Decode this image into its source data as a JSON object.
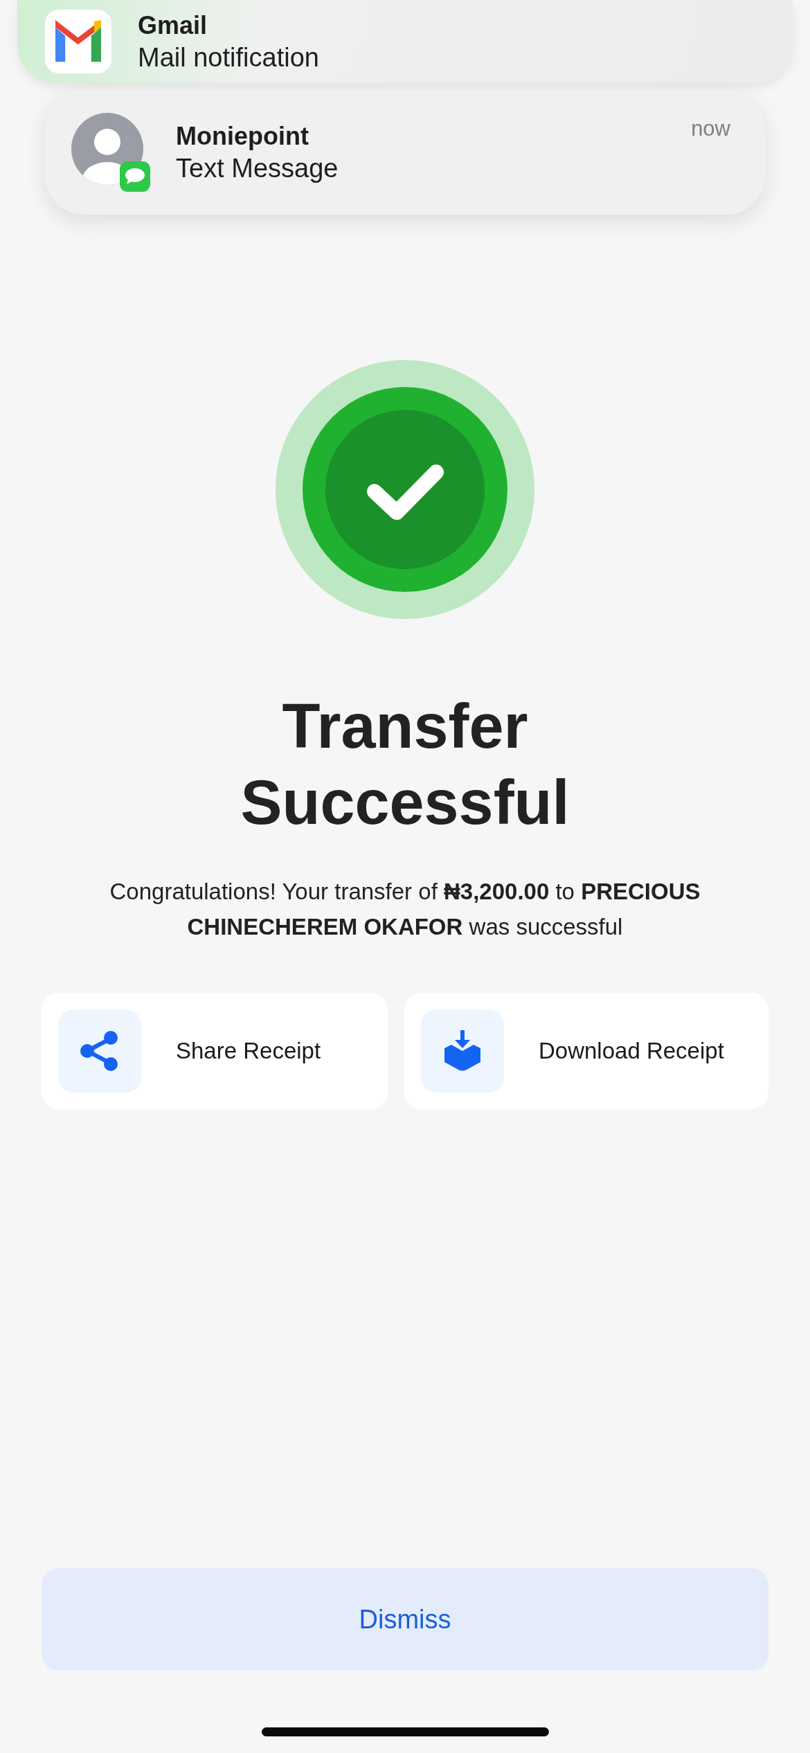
{
  "notifications": [
    {
      "kind": "mail",
      "title": "Gmail",
      "text": "Mail notification"
    },
    {
      "kind": "message",
      "title": "Moniepoint",
      "text": "Text Message",
      "time": "now"
    }
  ],
  "status": {
    "title": "Transfer Successful",
    "message": "Congratulations! Your transfer of **₦3,200.00** to **PRECIOUS CHINECHEREM OKAFOR** was successful"
  },
  "actions": [
    {
      "kind": "share",
      "label": "Share Receipt"
    },
    {
      "kind": "download",
      "label": "Download Receipt"
    }
  ],
  "dismiss": "Dismiss"
}
